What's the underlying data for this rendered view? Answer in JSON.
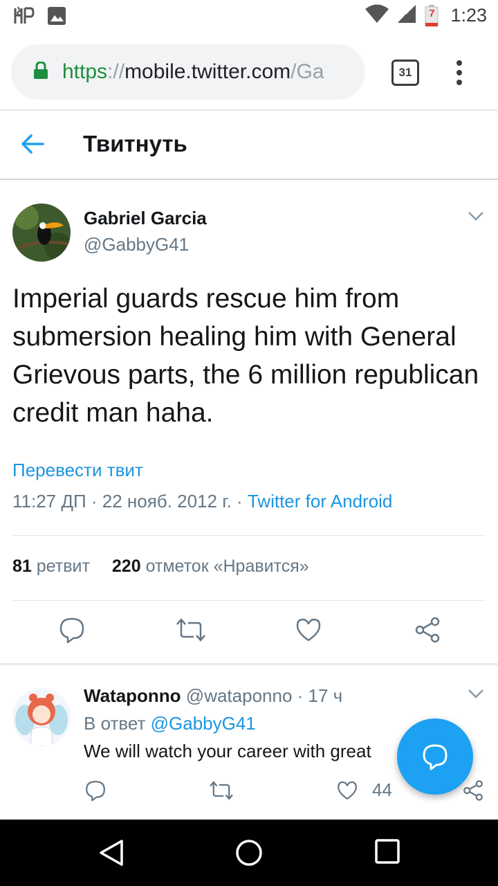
{
  "status_bar": {
    "time": "1:23",
    "battery_level": "7",
    "icons": [
      "harry-potter-glyph-icon",
      "image-icon",
      "wifi-icon",
      "cell-signal-icon",
      "battery-low-icon"
    ]
  },
  "browser": {
    "url_scheme": "https",
    "url_separator": "://",
    "url_host": "mobile.twitter.com",
    "url_tail": "/Ga",
    "tab_count": "31"
  },
  "header": {
    "title": "Твитнуть"
  },
  "tweet": {
    "author_name": "Gabriel Garcia",
    "author_handle": "@GabbyG41",
    "text": "Imperial guards rescue him from submersion healing him with General Grievous parts, the 6 million republican credit man haha.",
    "translate_label": "Перевести твит",
    "time": "11:27 ДП",
    "date": "22 нояб. 2012 г.",
    "separator": " · ",
    "source": "Twitter for Android",
    "retweet_count": "81",
    "retweet_label": "ретвит",
    "like_count": "220",
    "like_label": "отметок «Нравится»"
  },
  "reply": {
    "author_name": "Wataponno",
    "author_handle": "@wataponno",
    "age_separator": " · ",
    "age": "17 ч",
    "reply_prefix": "В ответ ",
    "reply_mention": "@GabbyG41",
    "text": "We will watch your career with great",
    "like_count": "44"
  },
  "colors": {
    "accent": "#1da1f2",
    "link": "#1b95e0",
    "secure_green": "#1e8e3e",
    "muted": "#657786"
  }
}
